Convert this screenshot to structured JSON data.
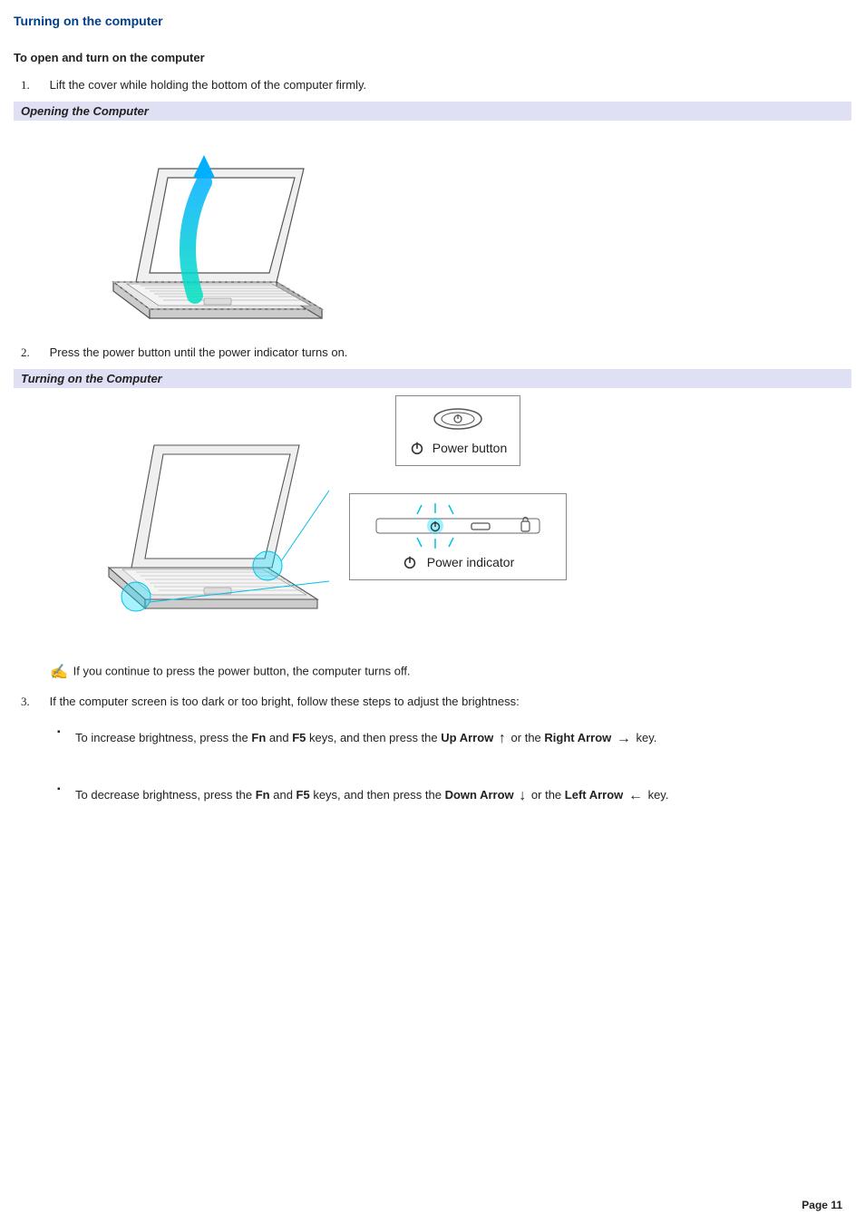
{
  "title": "Turning on the computer",
  "intro": "To open and turn on the computer",
  "steps": {
    "s1": {
      "num": "1.",
      "text": "Lift the cover while holding the bottom of the computer firmly."
    },
    "s2": {
      "num": "2.",
      "text": "Press the power button until the power indicator turns on."
    },
    "s3": {
      "num": "3.",
      "text": "If the computer screen is too dark or too bright, follow these steps to adjust the brightness:"
    }
  },
  "captions": {
    "fig1": "Opening the Computer",
    "fig2": "Turning on the Computer"
  },
  "fig2_labels": {
    "power_button": "Power button",
    "power_indicator": "Power indicator"
  },
  "note": "If you continue to press the power button, the computer turns off.",
  "bullets": {
    "b1": {
      "p1": "To increase brightness, press the ",
      "fn": "Fn",
      "and": " and ",
      "f5": "F5",
      "p2": " keys, and then press the ",
      "up": "Up Arrow",
      "p3": " or the ",
      "right": "Right Arrow",
      "p4": " key."
    },
    "b2": {
      "p1": "To decrease brightness, press the ",
      "fn": "Fn",
      "and": " and ",
      "f5": "F5",
      "p2": " keys, and then press the ",
      "down": "Down Arrow",
      "p3": " or the ",
      "left": "Left Arrow",
      "p4": " key."
    }
  },
  "arrows": {
    "up": "↑",
    "right": "→",
    "down": "↓",
    "left": "←"
  },
  "footer": "Page 11"
}
